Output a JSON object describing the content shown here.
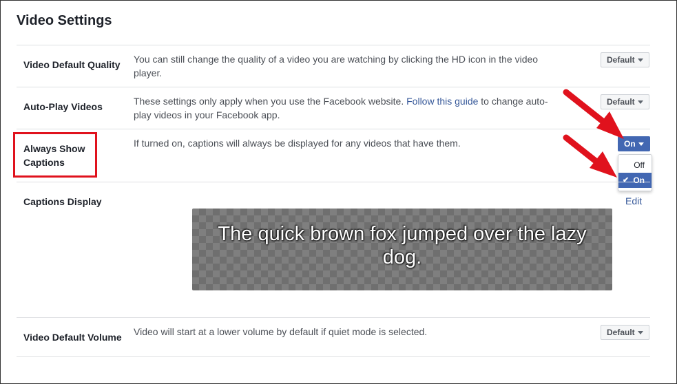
{
  "page": {
    "title": "Video Settings"
  },
  "rows": {
    "quality": {
      "label": "Video Default Quality",
      "desc_line1": "You can still change the quality of a video you are watching by clicking the HD icon in the video",
      "desc_line2": "player.",
      "button": "Default"
    },
    "autoplay": {
      "label": "Auto-Play Videos",
      "desc_pre": "These settings only apply when you use the Facebook website. ",
      "desc_link": "Follow this guide",
      "desc_post": " to change auto-",
      "desc_line2": "play videos in your Facebook app.",
      "button": "Default"
    },
    "captions": {
      "label_line1": "Always Show",
      "label_line2": "Captions",
      "desc": "If turned on, captions will always be displayed for any videos that have them.",
      "button": "On",
      "dropdown": {
        "options": [
          "Off",
          "On"
        ],
        "selected": "On",
        "check": "✔"
      }
    },
    "display": {
      "label": "Captions Display",
      "edit": "Edit",
      "preview_text": "The quick brown fox jumped over the lazy dog."
    },
    "volume": {
      "label": "Video Default Volume",
      "desc": "Video will start at a lower volume by default if quiet mode is selected.",
      "button": "Default"
    }
  },
  "colors": {
    "accent": "#4267b2",
    "annotation": "#e0121d",
    "link": "#365899"
  }
}
